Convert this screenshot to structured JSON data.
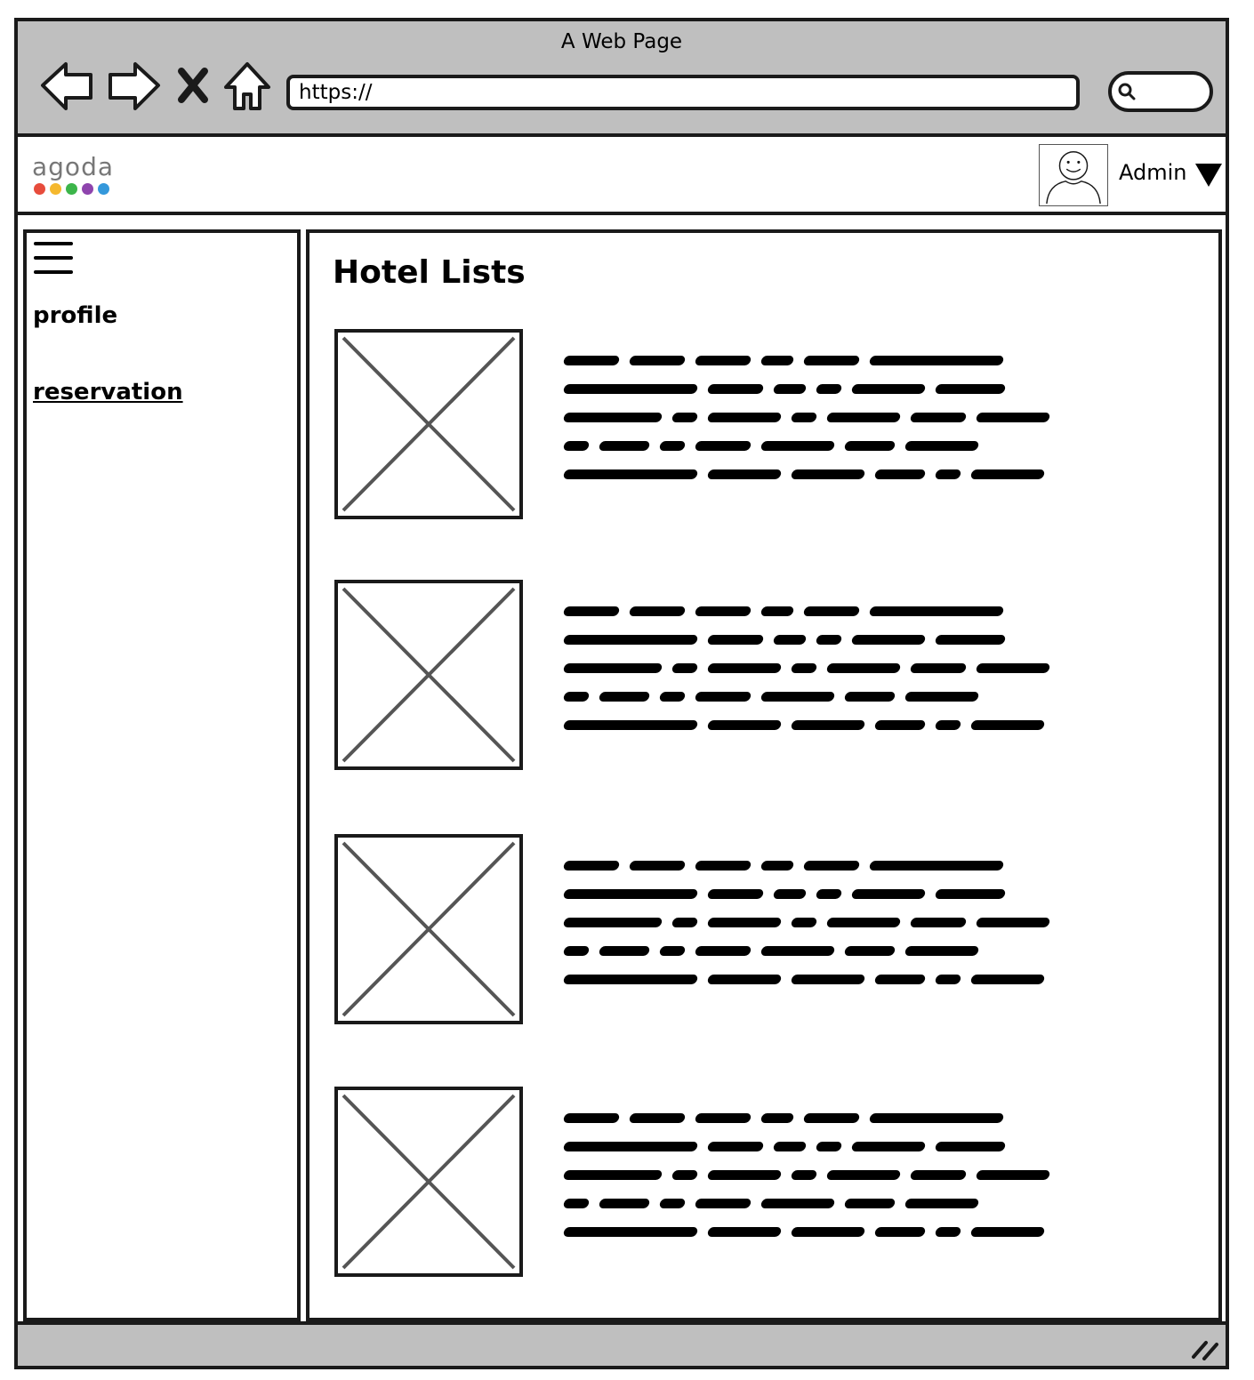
{
  "browser": {
    "window_title": "A Web Page",
    "url": "https://"
  },
  "header": {
    "logo_text": "agoda",
    "logo_dot_colors": [
      "#e74c3c",
      "#f5b82e",
      "#3cb54a",
      "#8e44ad",
      "#3498db"
    ],
    "user_name": "Admin"
  },
  "sidebar": {
    "items": [
      {
        "label": "profile",
        "style": "bold"
      },
      {
        "label": "reservation",
        "style": "underlined-link"
      }
    ]
  },
  "main": {
    "title": "Hotel Lists",
    "hotels": [
      {
        "image": "image-placeholder",
        "description": "placeholder-scribble-text"
      },
      {
        "image": "image-placeholder",
        "description": "placeholder-scribble-text"
      },
      {
        "image": "image-placeholder",
        "description": "placeholder-scribble-text"
      },
      {
        "image": "image-placeholder",
        "description": "placeholder-scribble-text"
      }
    ]
  },
  "icons": {
    "back": "arrow-left-icon",
    "forward": "arrow-right-icon",
    "stop": "close-icon",
    "home": "home-icon",
    "search": "search-icon",
    "avatar": "user-avatar-icon",
    "dropdown": "caret-down-icon",
    "menu": "hamburger-menu-icon",
    "resize": "resize-grip-icon"
  }
}
